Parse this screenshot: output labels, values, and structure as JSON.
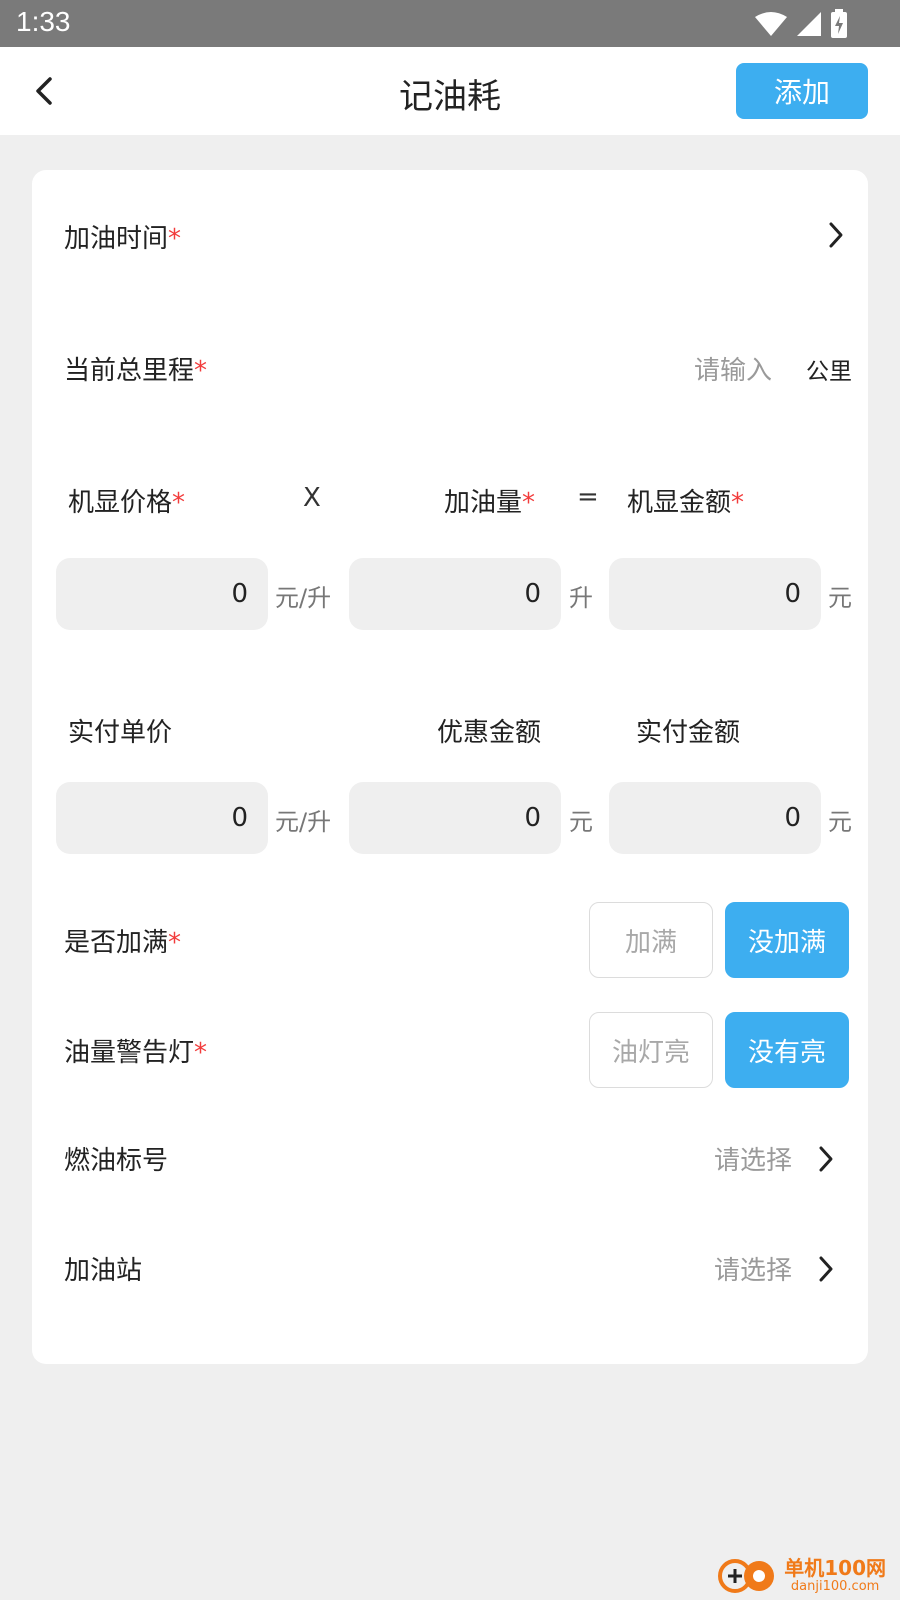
{
  "status_bar": {
    "time": "1:33"
  },
  "header": {
    "title": "记油耗",
    "add_label": "添加"
  },
  "form": {
    "fuel_time": {
      "label": "加油时间",
      "required": "*"
    },
    "odometer": {
      "label": "当前总里程",
      "required": "*",
      "placeholder": "请输入",
      "unit": "公里"
    },
    "machine_row": {
      "price_label": "机显价格",
      "price_required": "*",
      "times": "X",
      "volume_label": "加油量",
      "volume_required": "*",
      "equals": "=",
      "amount_label": "机显金额",
      "amount_required": "*",
      "price_value": "0",
      "price_unit": "元/升",
      "volume_value": "0",
      "volume_unit": "升",
      "amount_value": "0",
      "amount_unit": "元"
    },
    "paid_row": {
      "unit_price_label": "实付单价",
      "discount_label": "优惠金额",
      "paid_amount_label": "实付金额",
      "unit_price_value": "0",
      "unit_price_unit": "元/升",
      "discount_value": "0",
      "discount_unit": "元",
      "paid_amount_value": "0",
      "paid_amount_unit": "元"
    },
    "full_tank": {
      "label": "是否加满",
      "required": "*",
      "option_yes": "加满",
      "option_no": "没加满",
      "selected": "没加满"
    },
    "warning_light": {
      "label": "油量警告灯",
      "required": "*",
      "option_on": "油灯亮",
      "option_off": "没有亮",
      "selected": "没有亮"
    },
    "fuel_grade": {
      "label": "燃油标号",
      "placeholder": "请选择"
    },
    "station": {
      "label": "加油站",
      "placeholder": "请选择"
    }
  },
  "watermark": {
    "name": "单机100网",
    "url": "danji100.com"
  },
  "colors": {
    "accent": "#3daef0",
    "required": "#f23c3c",
    "background": "#efefef",
    "statusbar": "#7a7a7a",
    "watermark": "#f07a19"
  },
  "icons": [
    "wifi-icon",
    "signal-icon",
    "battery-charging-icon",
    "back-arrow-icon",
    "chevron-right-icon"
  ]
}
